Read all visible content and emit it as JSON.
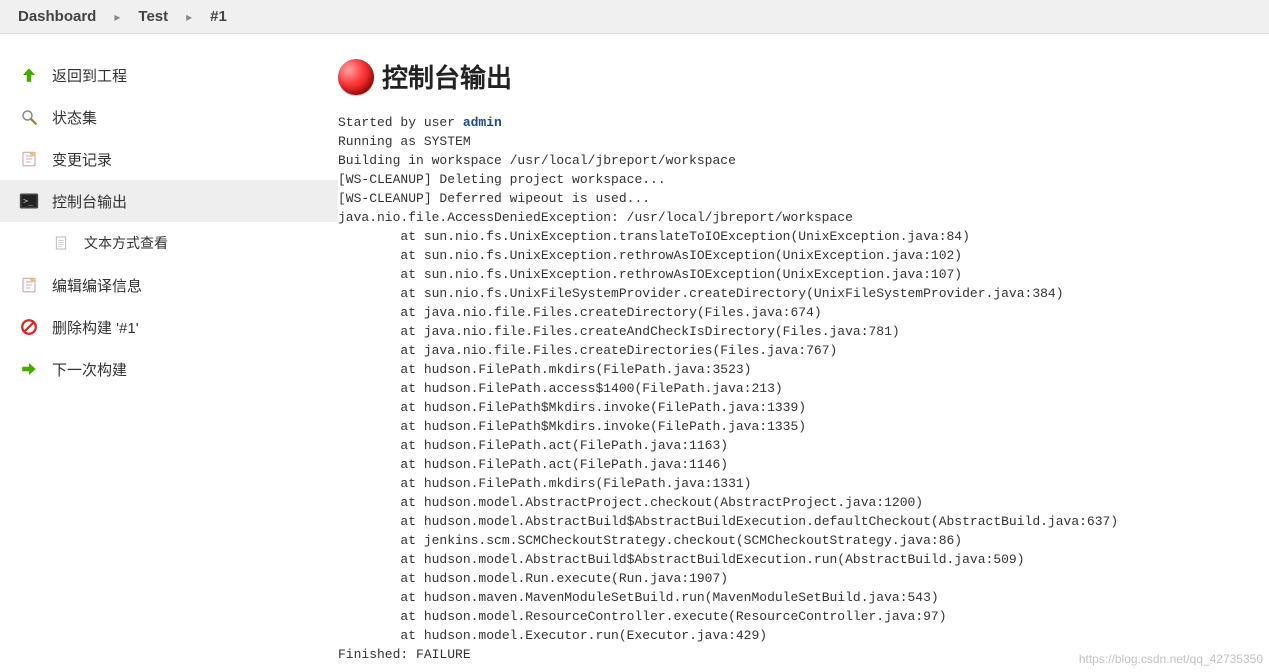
{
  "breadcrumb": {
    "dashboard": "Dashboard",
    "project": "Test",
    "build": "#1"
  },
  "sidebar": {
    "back": "返回到工程",
    "status": "状态集",
    "changes": "变更记录",
    "console": "控制台输出",
    "plain": "文本方式查看",
    "edit": "编辑编译信息",
    "delete": "删除构建 '#1'",
    "next": "下一次构建"
  },
  "page": {
    "title": "控制台输出"
  },
  "log": {
    "started_by": "Started by user ",
    "user": "admin",
    "body": "Running as SYSTEM\nBuilding in workspace /usr/local/jbreport/workspace\n[WS-CLEANUP] Deleting project workspace...\n[WS-CLEANUP] Deferred wipeout is used...\njava.nio.file.AccessDeniedException: /usr/local/jbreport/workspace\n\tat sun.nio.fs.UnixException.translateToIOException(UnixException.java:84)\n\tat sun.nio.fs.UnixException.rethrowAsIOException(UnixException.java:102)\n\tat sun.nio.fs.UnixException.rethrowAsIOException(UnixException.java:107)\n\tat sun.nio.fs.UnixFileSystemProvider.createDirectory(UnixFileSystemProvider.java:384)\n\tat java.nio.file.Files.createDirectory(Files.java:674)\n\tat java.nio.file.Files.createAndCheckIsDirectory(Files.java:781)\n\tat java.nio.file.Files.createDirectories(Files.java:767)\n\tat hudson.FilePath.mkdirs(FilePath.java:3523)\n\tat hudson.FilePath.access$1400(FilePath.java:213)\n\tat hudson.FilePath$Mkdirs.invoke(FilePath.java:1339)\n\tat hudson.FilePath$Mkdirs.invoke(FilePath.java:1335)\n\tat hudson.FilePath.act(FilePath.java:1163)\n\tat hudson.FilePath.act(FilePath.java:1146)\n\tat hudson.FilePath.mkdirs(FilePath.java:1331)\n\tat hudson.model.AbstractProject.checkout(AbstractProject.java:1200)\n\tat hudson.model.AbstractBuild$AbstractBuildExecution.defaultCheckout(AbstractBuild.java:637)\n\tat jenkins.scm.SCMCheckoutStrategy.checkout(SCMCheckoutStrategy.java:86)\n\tat hudson.model.AbstractBuild$AbstractBuildExecution.run(AbstractBuild.java:509)\n\tat hudson.model.Run.execute(Run.java:1907)\n\tat hudson.maven.MavenModuleSetBuild.run(MavenModuleSetBuild.java:543)\n\tat hudson.model.ResourceController.execute(ResourceController.java:97)\n\tat hudson.model.Executor.run(Executor.java:429)\nFinished: FAILURE"
  },
  "watermark": "https://blog.csdn.net/qq_42735350"
}
